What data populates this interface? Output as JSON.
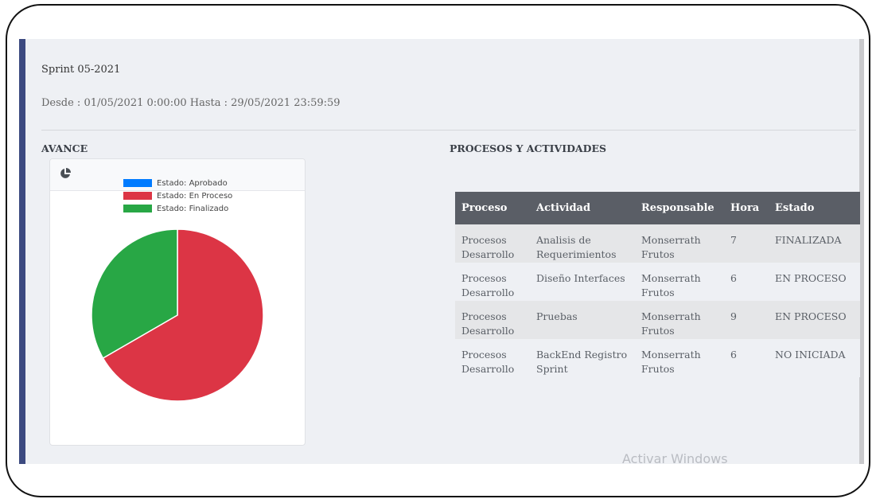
{
  "sprint": {
    "title": "Sprint 05-2021",
    "range": "Desde : 01/05/2021 0:00:00 Hasta : 29/05/2021 23:59:59"
  },
  "avance": {
    "heading": "AVANCE",
    "icon": "pie-chart-icon"
  },
  "procesos": {
    "heading": "PROCESOS Y ACTIVIDADES",
    "columns": [
      "Proceso",
      "Actividad",
      "Responsable",
      "Hora",
      "Estado"
    ],
    "rows": [
      [
        "Procesos Desarrollo",
        "Analisis de Requerimientos",
        "Monserrath Frutos",
        "7",
        "FINALIZADA"
      ],
      [
        "Procesos Desarrollo",
        "Diseño Interfaces",
        "Monserrath Frutos",
        "6",
        "EN PROCESO"
      ],
      [
        "Procesos Desarrollo",
        "Pruebas",
        "Monserrath Frutos",
        "9",
        "EN PROCESO"
      ],
      [
        "Procesos Desarrollo",
        "BackEnd Registro Sprint",
        "Monserrath Frutos",
        "6",
        "NO INICIADA"
      ]
    ]
  },
  "watermark": "Activar Windows",
  "chart_data": {
    "type": "pie",
    "categories": [
      "Estado: Aprobado",
      "Estado: En Proceso",
      "Estado: Finalizado"
    ],
    "values": [
      0,
      2,
      1
    ],
    "colors": [
      "#007bff",
      "#dc3545",
      "#28a745"
    ],
    "legend": "top"
  }
}
